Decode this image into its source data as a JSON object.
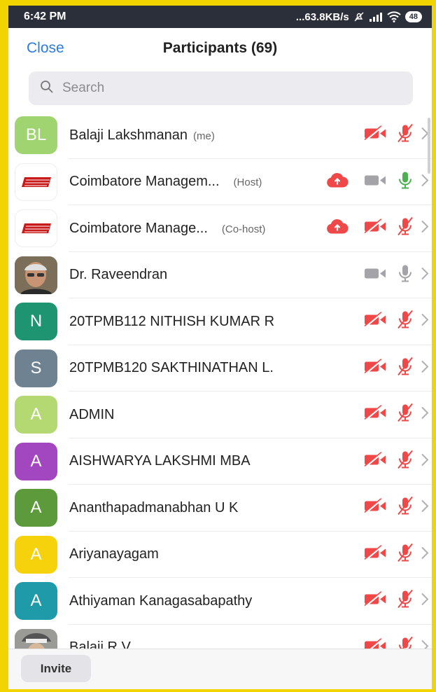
{
  "status_bar": {
    "time": "6:42 PM",
    "speed": "...63.8KB/s",
    "battery": "48",
    "icons": [
      "mute-icon",
      "signal-icon",
      "wifi-icon",
      "battery-icon"
    ]
  },
  "header": {
    "close_label": "Close",
    "title": "Participants (69)"
  },
  "search": {
    "placeholder": "Search"
  },
  "participants": [
    {
      "initials": "BL",
      "avatar_color": "#9fd471",
      "avatar_type": "initials",
      "name": "Balaji Lakshmanan",
      "tag": "(me)",
      "cloud": false,
      "video": "off",
      "mic": "muted"
    },
    {
      "initials": "CMA",
      "avatar_color": "#ffffff",
      "avatar_type": "logo",
      "name": "Coimbatore Managem...",
      "tag": "(Host)",
      "cloud": true,
      "video": "on",
      "mic": "active"
    },
    {
      "initials": "CMA",
      "avatar_color": "#ffffff",
      "avatar_type": "logo",
      "name": "Coimbatore Manage...",
      "tag": "(Co-host)",
      "cloud": true,
      "video": "off",
      "mic": "muted"
    },
    {
      "initials": "",
      "avatar_color": "#6e6a5c",
      "avatar_type": "photo",
      "name": "Dr. Raveendran",
      "tag": "",
      "cloud": false,
      "video": "on",
      "mic": "on"
    },
    {
      "initials": "N",
      "avatar_color": "#1e9470",
      "avatar_type": "initials",
      "name": "20TPMB112 NITHISH KUMAR R",
      "tag": "",
      "cloud": false,
      "video": "off",
      "mic": "muted"
    },
    {
      "initials": "S",
      "avatar_color": "#6e8291",
      "avatar_type": "initials",
      "name": "20TPMB120 SAKTHINATHAN L.",
      "tag": "",
      "cloud": false,
      "video": "off",
      "mic": "muted"
    },
    {
      "initials": "A",
      "avatar_color": "#b4d973",
      "avatar_type": "initials",
      "name": "ADMIN",
      "tag": "",
      "cloud": false,
      "video": "off",
      "mic": "muted"
    },
    {
      "initials": "A",
      "avatar_color": "#a347c0",
      "avatar_type": "initials",
      "name": "AISHWARYA LAKSHMI MBA",
      "tag": "",
      "cloud": false,
      "video": "off",
      "mic": "muted"
    },
    {
      "initials": "A",
      "avatar_color": "#5c9a3b",
      "avatar_type": "initials",
      "name": "Ananthapadmanabhan U K",
      "tag": "",
      "cloud": false,
      "video": "off",
      "mic": "muted"
    },
    {
      "initials": "A",
      "avatar_color": "#f5d20c",
      "avatar_type": "initials",
      "name": "Ariyanayagam",
      "tag": "",
      "cloud": false,
      "video": "off",
      "mic": "muted"
    },
    {
      "initials": "A",
      "avatar_color": "#1e9aa8",
      "avatar_type": "initials",
      "name": "Athiyaman Kanagasabapathy",
      "tag": "",
      "cloud": false,
      "video": "off",
      "mic": "muted"
    },
    {
      "initials": "",
      "avatar_color": "#8a8a86",
      "avatar_type": "photo",
      "name": "Balaji R V",
      "tag": "",
      "cloud": false,
      "video": "off",
      "mic": "muted"
    }
  ],
  "footer": {
    "invite_label": "Invite"
  },
  "colors": {
    "accent": "#2d7be0",
    "muted_red": "#f04848",
    "active_green": "#4caf50",
    "neutral_gray": "#a3a3a8"
  }
}
